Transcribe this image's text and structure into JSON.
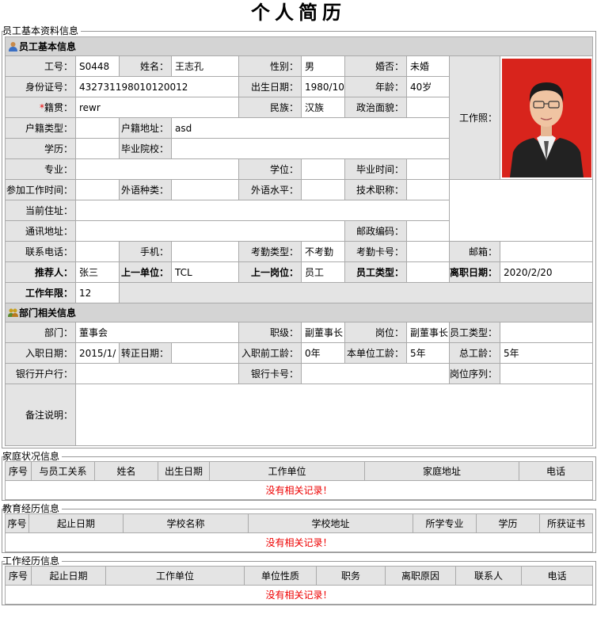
{
  "title": "个人简历",
  "sections": {
    "basic": "员工基本资料信息",
    "family": "家庭状况信息",
    "education": "教育经历信息",
    "work": "工作经历信息"
  },
  "employee": {
    "header": "员工基本信息",
    "labels": {
      "id": "工号：",
      "name": "姓名：",
      "gender": "性别：",
      "married": "婚否：",
      "idcard": "身份证号：",
      "birth": "出生日期：",
      "age": "年龄：",
      "native": "籍贯：",
      "nation": "民族：",
      "political": "政治面貌：",
      "hukou_type": "户籍类型：",
      "hukou_addr": "户籍地址：",
      "edu": "学历：",
      "school": "毕业院校：",
      "photo": "工作照：",
      "major": "专业：",
      "degree": "学位：",
      "grad_time": "毕业时间：",
      "work_start": "参加工作时间：",
      "lang_type": "外语种类：",
      "lang_level": "外语水平：",
      "title": "技术职称：",
      "current_addr": "当前住址：",
      "mail_addr": "通讯地址：",
      "postcode": "邮政编码：",
      "phone": "联系电话：",
      "mobile": "手机：",
      "attend_type": "考勤类型：",
      "attend_card": "考勤卡号：",
      "email": "邮箱：",
      "referrer": "推荐人：",
      "prev_unit": "上一单位：",
      "prev_post": "上一岗位：",
      "emp_type": "员工类型：",
      "leave_date": "离职日期：",
      "years": "工作年限："
    },
    "values": {
      "id": "S0448",
      "name": "王志孔",
      "gender": "男",
      "married": "未婚",
      "idcard": "432731198010120012",
      "birth": "1980/10",
      "age": "40岁",
      "native": "rewr",
      "nation": "汉族",
      "political": "",
      "hukou_type": "",
      "hukou_addr": "asd",
      "referrer": "张三",
      "prev_unit": "TCL",
      "prev_post": "员工",
      "attend_type": "不考勤",
      "leave_date": "2020/2/20",
      "years": "12"
    }
  },
  "dept": {
    "header": "部门相关信息",
    "labels": {
      "dept": "部门：",
      "rank": "职级：",
      "post": "岗位：",
      "emp_type": "员工类型：",
      "join": "入职日期：",
      "regular": "转正日期：",
      "pre_years": "入职前工龄：",
      "unit_years": "本单位工龄：",
      "total_years": "总工龄：",
      "bank": "银行开户行：",
      "bank_card": "银行卡号：",
      "post_seq": "岗位序列：",
      "remark": "备注说明："
    },
    "values": {
      "dept": "董事会",
      "rank": "副董事长",
      "post": "副董事长",
      "join": "2015/1/",
      "pre_years": "0年",
      "unit_years": "5年",
      "total_years": "5年"
    }
  },
  "family_table": {
    "headers": [
      "序号",
      "与员工关系",
      "姓名",
      "出生日期",
      "工作单位",
      "家庭地址",
      "电话"
    ],
    "empty": "没有相关记录！"
  },
  "education_table": {
    "headers": [
      "序号",
      "起止日期",
      "学校名称",
      "学校地址",
      "所学专业",
      "学历",
      "所获证书"
    ],
    "empty": "没有相关记录！"
  },
  "work_table": {
    "headers": [
      "序号",
      "起止日期",
      "工作单位",
      "单位性质",
      "职务",
      "离职原因",
      "联系人",
      "电话"
    ],
    "empty": "没有相关记录！"
  }
}
